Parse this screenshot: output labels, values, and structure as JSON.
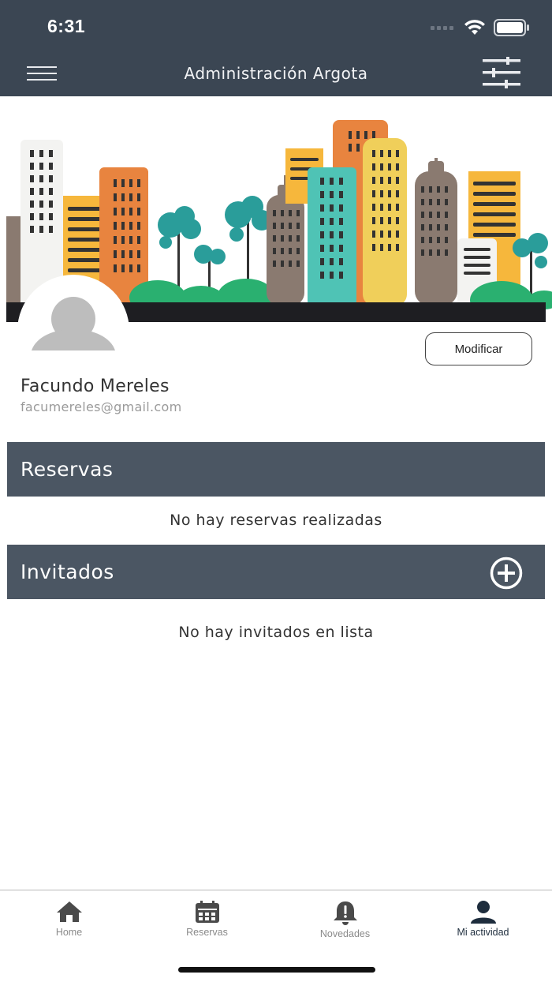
{
  "status_bar": {
    "time": "6:31"
  },
  "header": {
    "title": "Administración Argota"
  },
  "profile": {
    "name": "Facundo Mereles",
    "email": "facumereles@gmail.com",
    "modify_label": "Modificar"
  },
  "reservas": {
    "title": "Reservas",
    "empty_message": "No hay reservas realizadas"
  },
  "invitados": {
    "title": "Invitados",
    "empty_message": "No hay invitados en lista"
  },
  "tabs": [
    {
      "label": "Home",
      "icon": "home-icon",
      "active": false
    },
    {
      "label": "Reservas",
      "icon": "calendar-icon",
      "active": false
    },
    {
      "label": "Novedades",
      "icon": "bell-icon",
      "active": false
    },
    {
      "label": "Mi actividad",
      "icon": "person-icon",
      "active": true
    }
  ],
  "colors": {
    "header_bg": "#3b4653",
    "section_bg": "#4b5663",
    "active_tab": "#1e2d3d",
    "inactive_tab": "#8a8a8a"
  }
}
